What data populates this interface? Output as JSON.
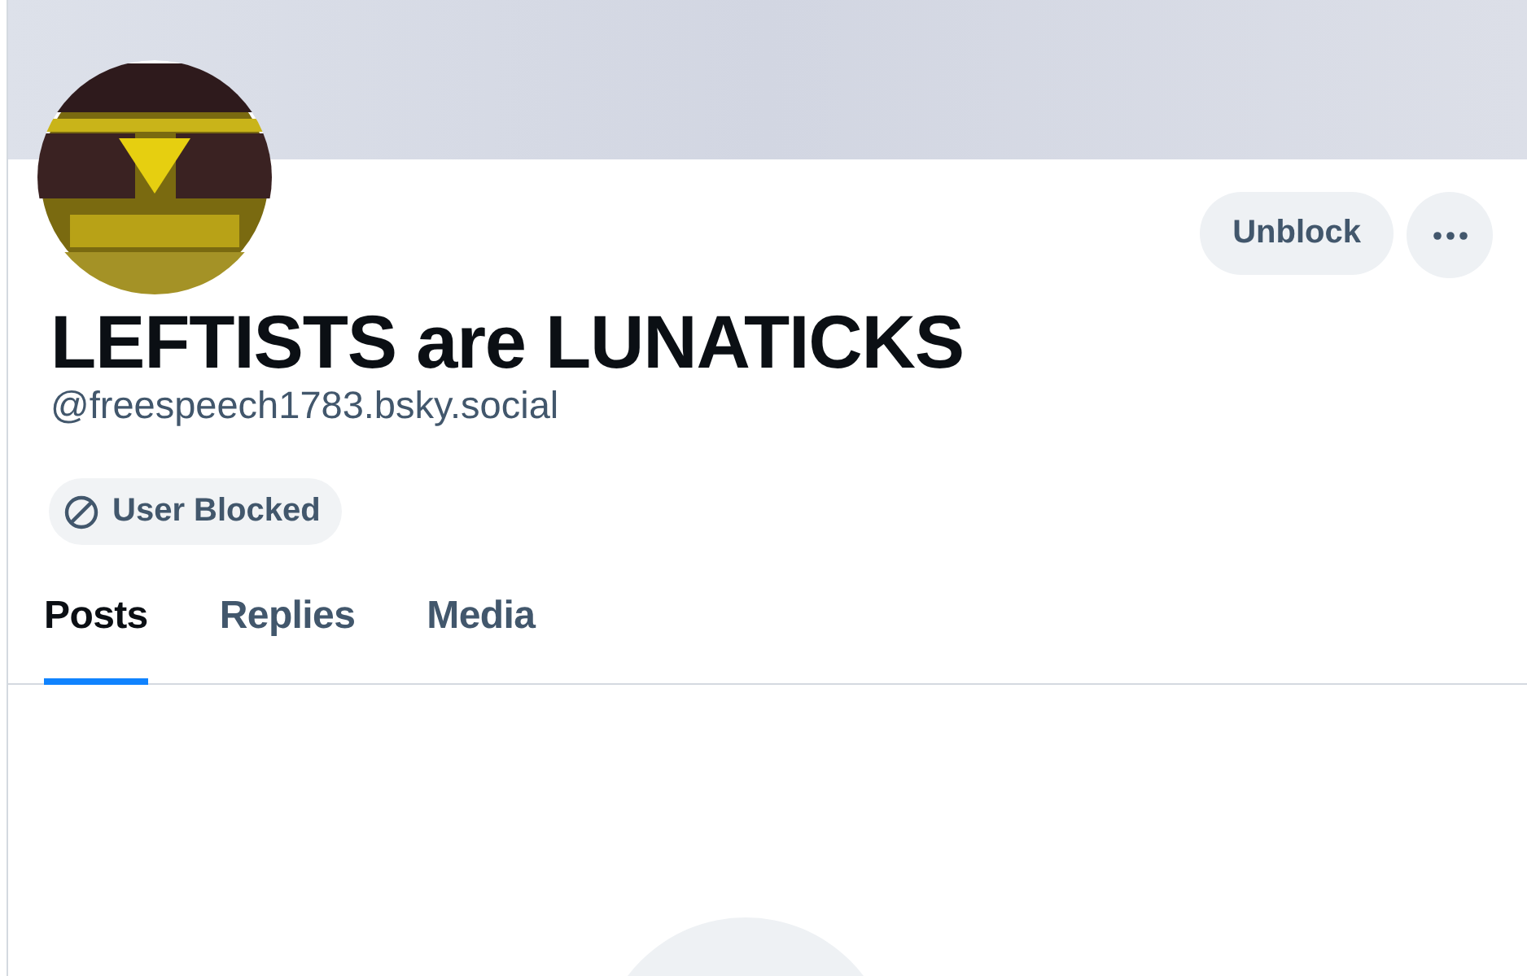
{
  "profile": {
    "display_name": "LEFTISTS are LUNATICKS",
    "handle": "@freespeech1783.bsky.social"
  },
  "actions": {
    "unblock": "Unblock"
  },
  "badge": {
    "label": "User Blocked"
  },
  "tabs": [
    {
      "label": "Posts",
      "selected": true
    },
    {
      "label": "Replies",
      "selected": false
    },
    {
      "label": "Media",
      "selected": false
    }
  ]
}
